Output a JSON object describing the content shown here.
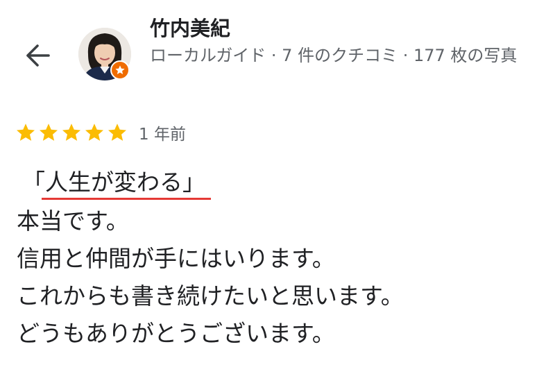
{
  "header": {
    "back_icon": "arrow-back-icon",
    "reviewer": {
      "name": "竹内美紀",
      "meta": "ローカルガイド · 7 件のクチコミ · 177 枚の写真",
      "badge_icon": "local-guide-star-icon",
      "badge_color": "#ef6c00"
    }
  },
  "review": {
    "rating": 5,
    "star_color": "#fbbc04",
    "date": "1 年前",
    "headline": "「人生が変わる」",
    "headline_underline_color": "#e53935",
    "lines": [
      "本当です。",
      "信用と仲間が手にはいります。",
      "これからも書き続けたいと思います。",
      "どうもありがとうございます。"
    ]
  }
}
